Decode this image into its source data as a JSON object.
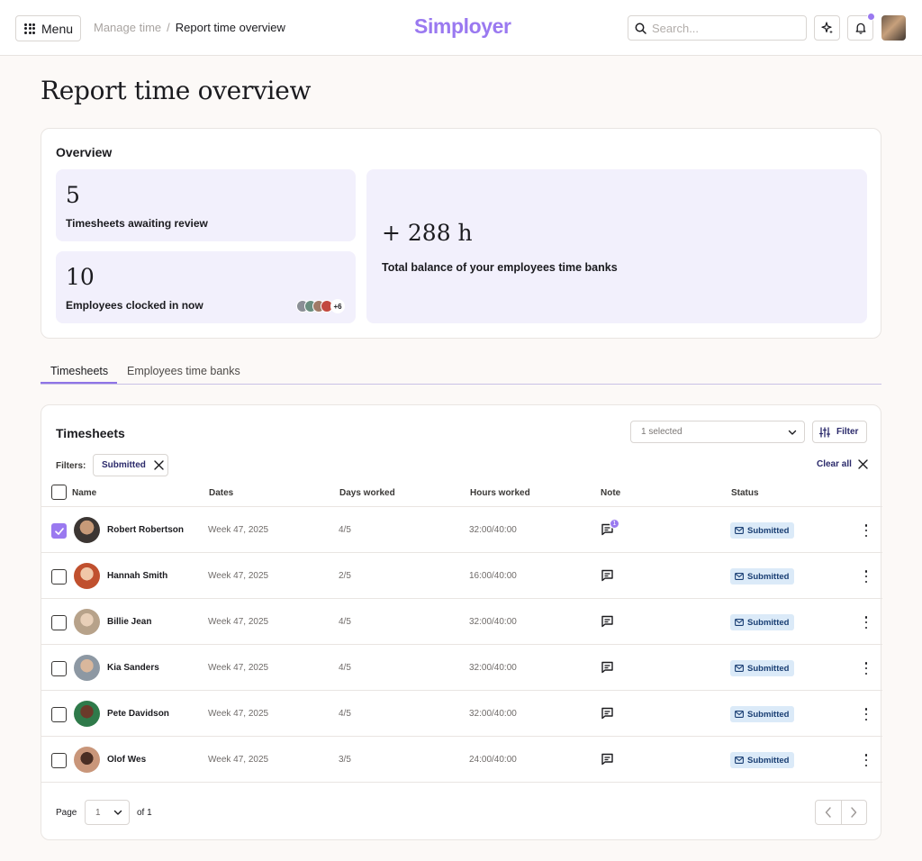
{
  "header": {
    "menu_label": "Menu",
    "breadcrumb_parent": "Manage time",
    "breadcrumb_separator": "/",
    "breadcrumb_current": "Report time overview",
    "logo": "Simployer",
    "search_placeholder": "Search..."
  },
  "page": {
    "title": "Report time overview"
  },
  "overview": {
    "title": "Overview",
    "awaiting": {
      "value": "5",
      "label": "Timesheets awaiting review"
    },
    "clocked_in": {
      "value": "10",
      "label": "Employees clocked in now",
      "more": "+6"
    },
    "balance": {
      "value": "+ 288 h",
      "label": "Total balance of your employees time banks"
    }
  },
  "tabs": [
    {
      "label": "Timesheets",
      "active": true
    },
    {
      "label": "Employees time banks",
      "active": false
    }
  ],
  "timesheets": {
    "title": "Timesheets",
    "selection": "1 selected",
    "filter_label": "Filter",
    "filters_label": "Filters:",
    "active_filter": "Submitted",
    "clear_all": "Clear all",
    "columns": [
      "Name",
      "Dates",
      "Days worked",
      "Hours worked",
      "Note",
      "Status"
    ],
    "rows": [
      {
        "name": "Robert Robertson",
        "dates": "Week 47, 2025",
        "days": "4/5",
        "hours": "32:00/40:00",
        "note_count": "1",
        "status": "Submitted",
        "checked": true
      },
      {
        "name": "Hannah Smith",
        "dates": "Week 47, 2025",
        "days": "2/5",
        "hours": "16:00/40:00",
        "status": "Submitted",
        "checked": false
      },
      {
        "name": "Billie Jean",
        "dates": "Week 47, 2025",
        "days": "4/5",
        "hours": "32:00/40:00",
        "status": "Submitted",
        "checked": false
      },
      {
        "name": "Kia Sanders",
        "dates": "Week 47, 2025",
        "days": "4/5",
        "hours": "32:00/40:00",
        "status": "Submitted",
        "checked": false
      },
      {
        "name": "Pete Davidson",
        "dates": "Week 47, 2025",
        "days": "4/5",
        "hours": "32:00/40:00",
        "status": "Submitted",
        "checked": false
      },
      {
        "name": "Olof Wes",
        "dates": "Week 47, 2025",
        "days": "3/5",
        "hours": "24:00/40:00",
        "status": "Submitted",
        "checked": false
      }
    ],
    "pagination": {
      "page_label": "Page",
      "current_page": "1",
      "of_label": "of 1"
    }
  },
  "colors": {
    "accent": "#9a79f0",
    "status_bg": "#dbeaf8",
    "status_text": "#1a3f74",
    "stat_bg": "#f2f0fc"
  }
}
